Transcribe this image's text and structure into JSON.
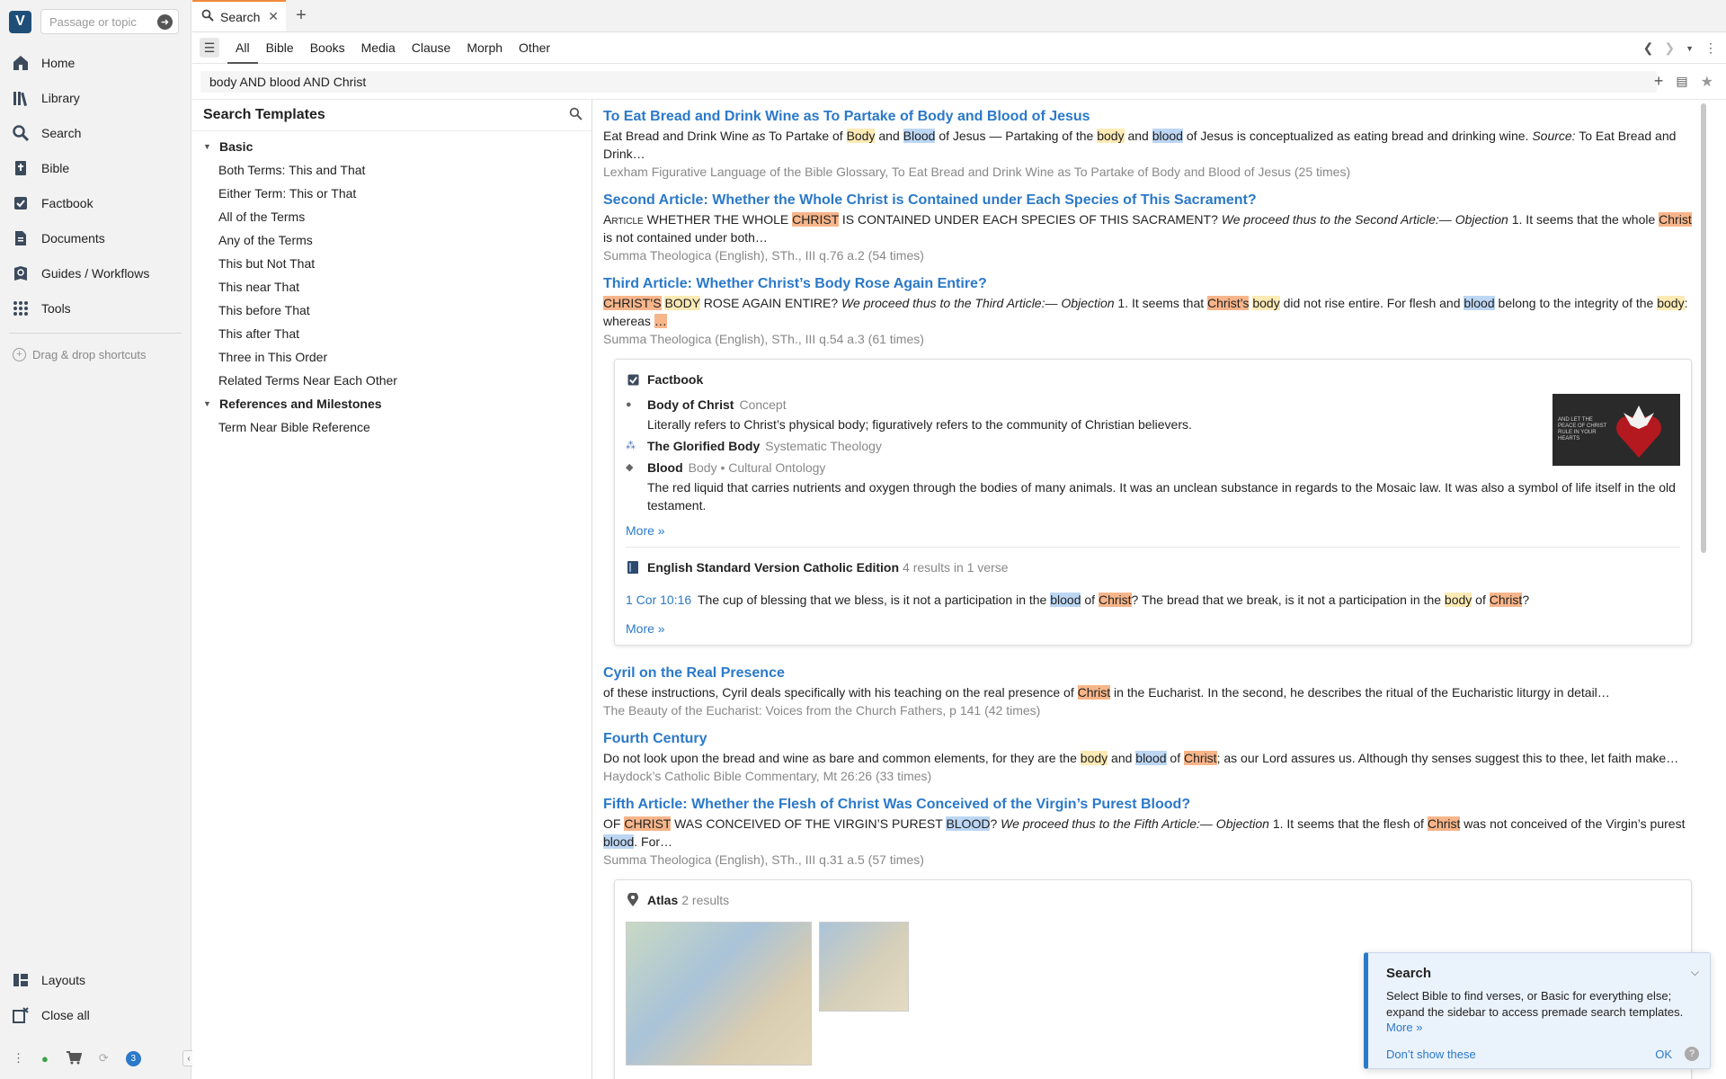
{
  "nav": {
    "passage_placeholder": "Passage or topic",
    "items": [
      {
        "label": "Home",
        "icon": "home-icon"
      },
      {
        "label": "Library",
        "icon": "library-icon"
      },
      {
        "label": "Search",
        "icon": "search-icon"
      },
      {
        "label": "Bible",
        "icon": "bible-icon"
      },
      {
        "label": "Factbook",
        "icon": "factbook-icon"
      },
      {
        "label": "Documents",
        "icon": "documents-icon"
      },
      {
        "label": "Guides / Workflows",
        "icon": "guides-icon"
      },
      {
        "label": "Tools",
        "icon": "tools-icon"
      }
    ],
    "drag_drop": "Drag & drop shortcuts",
    "bottom": [
      {
        "label": "Layouts",
        "icon": "layouts-icon"
      },
      {
        "label": "Close all",
        "icon": "close-all-icon"
      }
    ],
    "notification_count": "3"
  },
  "tab": {
    "label": "Search"
  },
  "search": {
    "kinds": [
      "All",
      "Bible",
      "Books",
      "Media",
      "Clause",
      "Morph",
      "Other"
    ],
    "active_kind": "All",
    "query": "body AND blood AND Christ"
  },
  "templates": {
    "title": "Search Templates",
    "groups": [
      {
        "name": "Basic",
        "items": [
          "Both Terms: This and That",
          "Either Term: This or That",
          "All of the Terms",
          "Any of the Terms",
          "This but Not That",
          "This near That",
          "This before That",
          "This after That",
          "Three in This Order",
          "Related Terms Near Each Other"
        ]
      },
      {
        "name": "References and Milestones",
        "items": [
          "Term Near Bible Reference"
        ]
      }
    ]
  },
  "results": {
    "r1": {
      "title": "To Eat Bread and Drink Wine as To Partake of Body and Blood of Jesus",
      "source": "Lexham Figurative Language of the Bible Glossary, To Eat Bread and Drink Wine as To Partake of Body and Blood of Jesus (25 times)"
    },
    "r2": {
      "title": "Second Article: Whether the Whole Christ is Contained under Each Species of This Sacrament?",
      "source": "Summa Theologica (English), STh., III q.76 a.2 (54 times)"
    },
    "r3": {
      "title": "Third Article: Whether Christ’s Body Rose Again Entire?",
      "source": "Summa Theologica (English), STh., III q.54 a.3 (61 times)"
    },
    "factbook": {
      "heading": "Factbook",
      "entries": [
        {
          "name": "Body of Christ",
          "type": "Concept",
          "desc": "Literally refers to Christ’s physical body; figuratively refers to the community of Christian believers."
        },
        {
          "name": "The Glorified Body",
          "type": "Systematic Theology",
          "desc": ""
        },
        {
          "name": "Blood",
          "type": "Body • Cultural Ontology",
          "desc": "The red liquid that carries nutrients and oxygen through the bodies of many animals. It was an unclean substance in regards to the Mosaic law. It was also a symbol of life itself in the old testament."
        }
      ],
      "image_caption": "AND LET THE PEACE OF CHRIST RULE IN YOUR HEARTS",
      "more": "More »"
    },
    "esv": {
      "heading": "English Standard Version Catholic Edition",
      "count": "4 results in 1 verse",
      "ref": "1 Cor 10:16",
      "more": "More »"
    },
    "r4": {
      "title": "Cyril on the Real Presence",
      "source": "The Beauty of the Eucharist: Voices from the Church Fathers, p 141 (42 times)"
    },
    "r5": {
      "title": "Fourth Century",
      "source": "Haydock’s Catholic Bible Commentary, Mt 26:26 (33 times)"
    },
    "r6": {
      "title": "Fifth Article: Whether the Flesh of Christ Was Conceived of the Virgin’s Purest Blood?",
      "source": "Summa Theologica (English), STh., III q.31 a.5 (57 times)"
    },
    "atlas": {
      "heading": "Atlas",
      "count": "2 results"
    }
  },
  "popup": {
    "title": "Search",
    "body": "Select Bible to find verses, or Basic for everything else; expand the sidebar to access premade search templates.",
    "more": "More »",
    "dont_show": "Don’t show these",
    "ok": "OK"
  },
  "colors": {
    "accent": "#2b79c9",
    "tab_accent": "#f08a3c",
    "hl_body": "#fdeab4",
    "hl_blood": "#bcd6f4",
    "hl_christ": "#f7b58a"
  }
}
